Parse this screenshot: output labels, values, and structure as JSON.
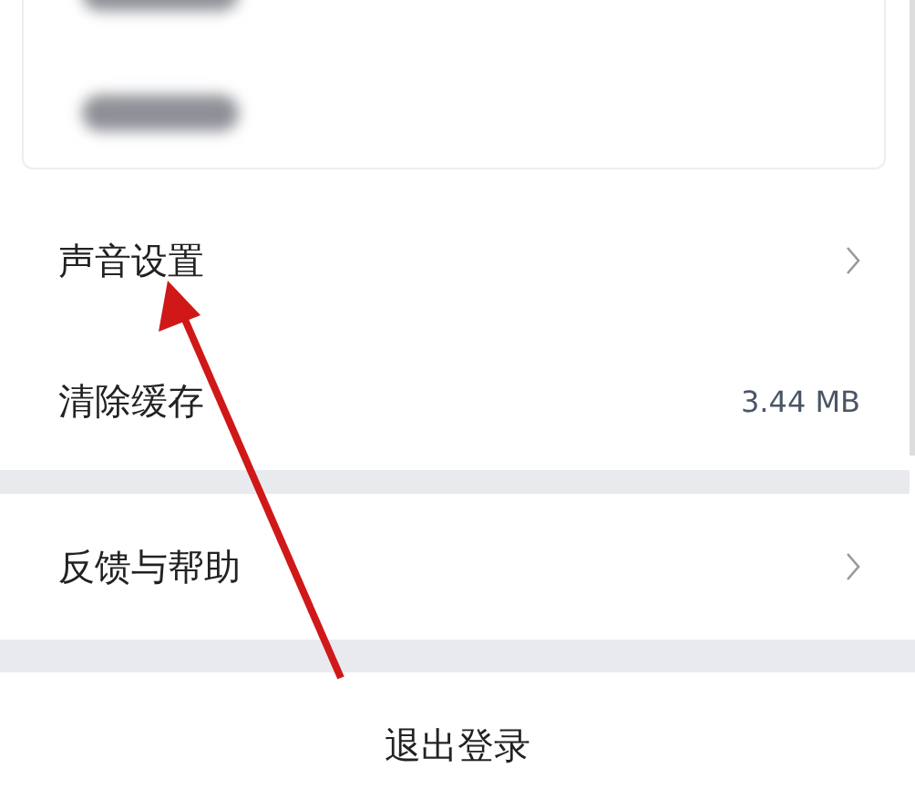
{
  "settings": [
    {
      "kind": "link",
      "label": "声音设置"
    },
    {
      "kind": "value",
      "label": "清除缓存",
      "value": "3.44 MB"
    }
  ],
  "help": [
    {
      "kind": "link",
      "label": "反馈与帮助"
    }
  ],
  "logout": {
    "label": "退出登录"
  }
}
